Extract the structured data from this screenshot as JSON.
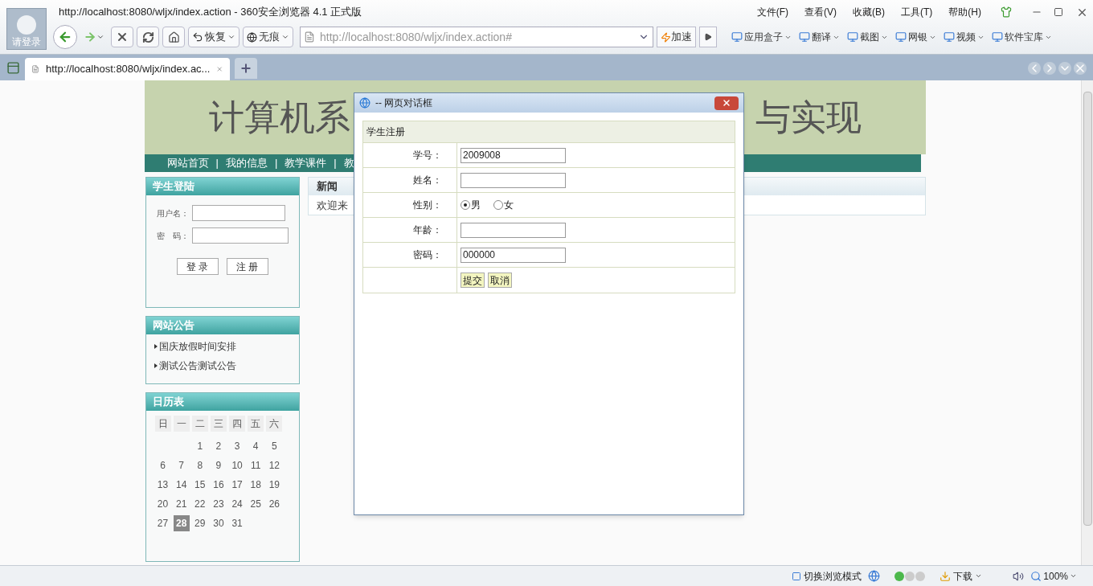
{
  "browser": {
    "title": "http://localhost:8080/wljx/index.action - 360安全浏览器 4.1 正式版",
    "login_label": "请登录",
    "menus": [
      "文件(F)",
      "查看(V)",
      "收藏(B)",
      "工具(T)",
      "帮助(H)"
    ],
    "toolbar": {
      "restore": "恢复",
      "incognito": "无痕",
      "address": "http://localhost:8080/wljx/index.action#",
      "speedup": "加速"
    },
    "addons": [
      "应用盒子",
      "翻译",
      "截图",
      "网银",
      "视频",
      "软件宝库"
    ],
    "tabs": [
      {
        "label": "http://localhost:8080/wljx/index.ac...",
        "selected": true
      }
    ]
  },
  "page": {
    "banner_left": "计算机系",
    "banner_right": "与实现",
    "nav": [
      "网站首页",
      "我的信息",
      "教学课件",
      "教"
    ],
    "nav_separator": "|",
    "login": {
      "title": "学生登陆",
      "username_label": "用户名：",
      "password_label": "密　码：",
      "buttons": [
        "登 录",
        "注 册"
      ]
    },
    "notices": {
      "title": "网站公告",
      "items": [
        "国庆放假时间安排",
        "测试公告测试公告"
      ]
    },
    "calendar": {
      "title": "日历表",
      "weekdays": [
        "日",
        "一",
        "二",
        "三",
        "四",
        "五",
        "六"
      ],
      "weeks": [
        {
          "kind": "leading",
          "days": [
            {
              "label": "1",
              "selected": false
            },
            {
              "label": "2",
              "selected": false
            },
            {
              "label": "3",
              "selected": false
            },
            {
              "label": "4",
              "selected": false
            },
            {
              "label": "5",
              "selected": false
            }
          ]
        },
        {
          "kind": "full",
          "days": [
            {
              "label": "6",
              "selected": false
            },
            {
              "label": "7",
              "selected": false
            },
            {
              "label": "8",
              "selected": false
            },
            {
              "label": "9",
              "selected": false
            },
            {
              "label": "10",
              "selected": false
            },
            {
              "label": "11",
              "selected": false
            },
            {
              "label": "12",
              "selected": false
            }
          ]
        },
        {
          "kind": "full",
          "days": [
            {
              "label": "13",
              "selected": false
            },
            {
              "label": "14",
              "selected": false
            },
            {
              "label": "15",
              "selected": false
            },
            {
              "label": "16",
              "selected": false
            },
            {
              "label": "17",
              "selected": false
            },
            {
              "label": "18",
              "selected": false
            },
            {
              "label": "19",
              "selected": false
            }
          ]
        },
        {
          "kind": "full",
          "days": [
            {
              "label": "20",
              "selected": false
            },
            {
              "label": "21",
              "selected": false
            },
            {
              "label": "22",
              "selected": false
            },
            {
              "label": "23",
              "selected": false
            },
            {
              "label": "24",
              "selected": false
            },
            {
              "label": "25",
              "selected": false
            },
            {
              "label": "26",
              "selected": false
            }
          ]
        },
        {
          "kind": "trailing",
          "days": [
            {
              "label": "27",
              "selected": false
            },
            {
              "label": "28",
              "selected": true
            },
            {
              "label": "29",
              "selected": false
            },
            {
              "label": "30",
              "selected": false
            },
            {
              "label": "31",
              "selected": false
            }
          ]
        }
      ]
    },
    "news": {
      "title": "新闻",
      "text": "欢迎来"
    }
  },
  "dialog": {
    "title": "-- 网页对话框",
    "form_title": "学生注册",
    "fields": [
      {
        "kind": "text",
        "label": "学号：",
        "value": "2009008"
      },
      {
        "kind": "text",
        "label": "姓名："
      },
      {
        "kind": "radio",
        "label": "性别：",
        "options": [
          {
            "label": "男",
            "selected": true
          },
          {
            "label": "女",
            "selected": false
          }
        ]
      },
      {
        "kind": "text",
        "label": "年龄："
      },
      {
        "kind": "text",
        "label": "密码：",
        "value": "000000"
      }
    ],
    "buttons": [
      "提交",
      "取消"
    ]
  },
  "status_bar": {
    "mode": "切换浏览模式",
    "download": "下载",
    "zoom": "100%"
  }
}
